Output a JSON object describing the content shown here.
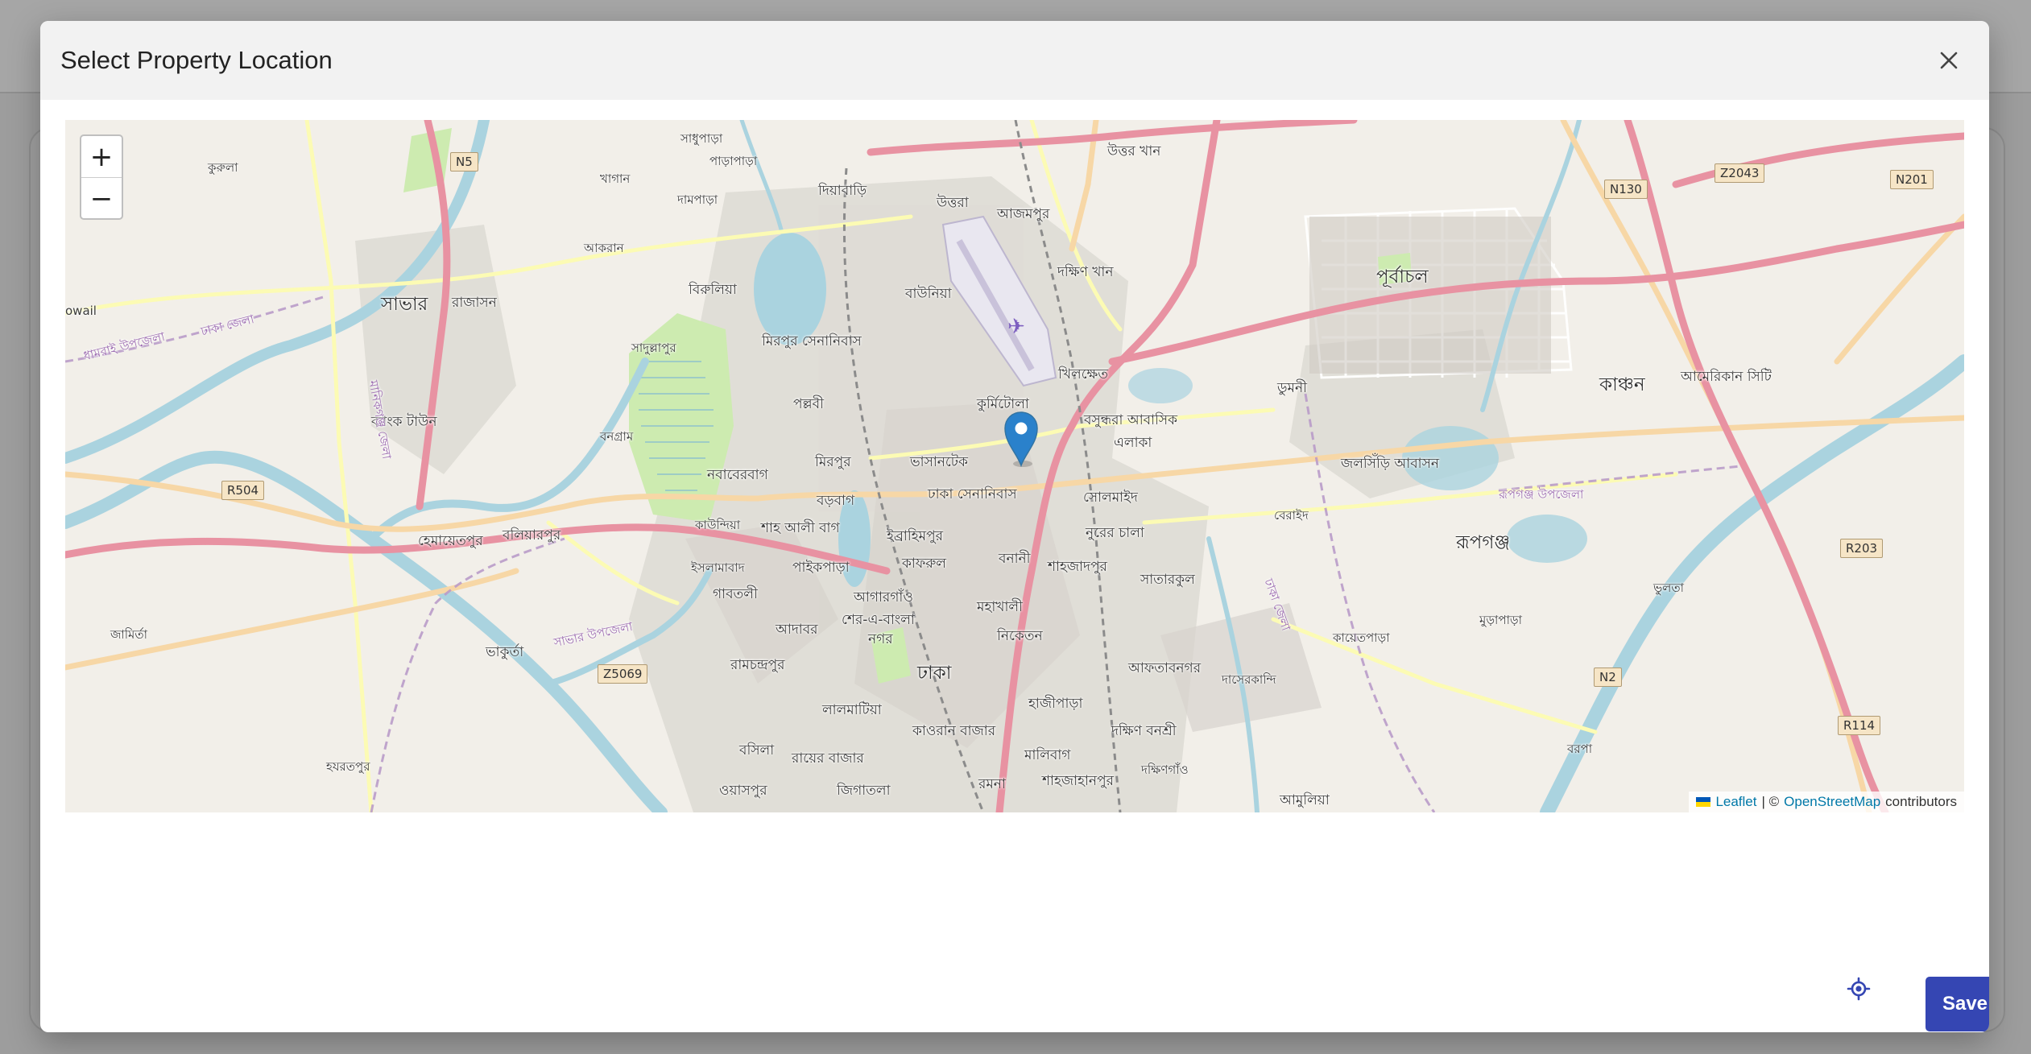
{
  "dialog": {
    "title": "Select Property Location",
    "save_label": "Save"
  },
  "map": {
    "zoom_in": "+",
    "zoom_out": "−",
    "attribution": {
      "leaflet": "Leaflet",
      "separator": "| ©",
      "osm": "OpenStreetMap",
      "suffix": "contributors"
    },
    "labels": {
      "kurla": "কুরুলা",
      "savar": "সাভার",
      "rajason": "রাজাসন",
      "bank_town": "ব্যাংক টাউন",
      "hemayetpur": "হেমায়েতপুর",
      "boliarpur": "বলিয়ারপুর",
      "jamirta": "জামির্তা",
      "bhakurta": "ভাকুর্তা",
      "hazratpur": "হযরতপুর",
      "akran": "আকরান",
      "khagan": "খাগান",
      "sadhupara": "সাধুপাড়া",
      "parapara": "পাড়াপাড়া",
      "dampara": "দামপাড়া",
      "birulia": "বিরুলিয়া",
      "sadullapur": "সাদুল্লাপুর",
      "bongram": "বনগ্রাম",
      "nababerbag": "নবাবেরবাগ",
      "mirpur_cantonment": "মিরপুর সেনানিবাস",
      "pallabi": "পল্লবী",
      "mirpur": "মিরপুর",
      "boragbag": "বড়বাগ",
      "shah_ali_bag": "শাহ আলী বাগ",
      "kaundia": "কাউন্দিয়া",
      "islambad": "ইসলামাবাদ",
      "gabtoli": "গাবতলী",
      "paikpara": "পাইকপাড়া",
      "agargaon": "আগারগাঁও",
      "sher_e_bangla": "শের-এ-বাংলা",
      "nagar": "নগর",
      "adabar": "আদাবর",
      "ramchandrapur": "রামচন্দ্রপুর",
      "lalmatia": "লালমাটিয়া",
      "basila": "বসিলা",
      "rayerbazar": "রায়ের বাজার",
      "wasapur": "ওয়াসপুর",
      "jigatola": "জিগাতলা",
      "diabari": "দিয়াবাড়ি",
      "uttara": "উত্তরা",
      "azampur": "আজমপুর",
      "uttar_khan": "উত্তর খান",
      "dakshin_khan": "দক্ষিণ খান",
      "bauniya": "বাউনিয়া",
      "khilkhet": "খিলক্ষেত",
      "kurmitola": "কুর্মিটোলা",
      "bashundhara": "বসুন্ধরা আবাসিক",
      "elaka": "এলাকা",
      "bhasantek": "ভাসানটেক",
      "dhaka_cantonment": "ঢাকা সেনানিবাস",
      "ibrahimpur": "ইব্রাহিমপুর",
      "kafrul": "কাফরুল",
      "banani": "বনানী",
      "solmaid": "সোলমাইদ",
      "nurer_chala": "নুরের চালা",
      "shahjadpur": "শাহজাদপুর",
      "satarkul": "সাতারকুল",
      "mohakhali": "মহাখালী",
      "niketan": "নিকেতন",
      "dhaka": "ঢাকা",
      "aftabnagar": "আফতাবনগর",
      "hajipara": "হাজীপাড়া",
      "kawran_bazar": "কাওরান বাজার",
      "dakshin_banasree": "দক্ষিণ বনশ্রী",
      "malibag": "মালিবাগ",
      "shahjahanpur": "শাহজাহানপুর",
      "ramna": "রমনা",
      "dakshingaon": "দক্ষিণগাঁও",
      "dasherkandi": "দাসেরকান্দি",
      "amulia": "আমুলিয়া",
      "purbachal": "পূর্বাচল",
      "dumni": "ডুমনী",
      "jolshiri": "জলসিঁড়ি আবাসন",
      "beraid": "বেরাইদ",
      "kanchan": "কাঞ্চন",
      "american_city": "আমেরিকান সিটি",
      "rupganj_upazila": "রূপগঞ্জ উপজেলা",
      "rupganj": "রূপগঞ্জ",
      "bhulta": "ভুলতা",
      "kayetpara": "কায়েতপাড়া",
      "murapara": "মুড়াপাড়া",
      "barpa": "বরপা",
      "dhaka_district": "ঢাকা জেলা",
      "savar_upazila": "সাভার উপজেলা",
      "dhamrai_upazila": "ধামরাই উপজেলা",
      "dhaka_jela_east": "ঢাকা জেলা",
      "nowail": "owail",
      "manikganj": "মানিকগঞ্জ জেলা"
    },
    "shields": {
      "n5": "N5",
      "r504": "R504",
      "z5069": "Z5069",
      "n130": "N130",
      "z2043": "Z2043",
      "n201": "N201",
      "r203": "R203",
      "n2": "N2",
      "r114": "R114"
    }
  },
  "colors": {
    "accent": "#3546b3",
    "marker": "#2a81cb",
    "land": "#f2efe9",
    "urban": "#dddddd",
    "park": "#cdebb0",
    "water": "#aad3df",
    "primary_road": "#e892a2",
    "secondary_road": "#f7d7a6",
    "tertiary_road": "#fcfbb4"
  },
  "icons": {
    "close": "close-icon",
    "marker": "map-marker-icon",
    "locate": "my-location-icon"
  }
}
